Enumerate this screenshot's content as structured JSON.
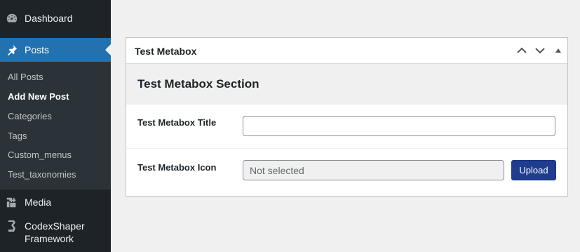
{
  "sidebar": {
    "dashboard": {
      "label": "Dashboard",
      "icon": "dashboard-icon"
    },
    "posts": {
      "label": "Posts",
      "icon": "pin-icon"
    },
    "submenu": [
      "All Posts",
      "Add New Post",
      "Categories",
      "Tags",
      "Custom_menus",
      "Test_taxonomies"
    ],
    "media": {
      "label": "Media",
      "icon": "media-icon"
    },
    "codexshaper": {
      "label_line1": "CodexShaper",
      "label_line2": "Framework",
      "icon": "codexshaper-icon"
    },
    "current_color": "#2271b1"
  },
  "metabox": {
    "title": "Test Metabox",
    "section_title": "Test Metabox Section",
    "fields": {
      "title_label": "Test Metabox Title",
      "title_value": "",
      "icon_label": "Test Metabox Icon",
      "icon_value": "Not selected",
      "upload_label": "Upload"
    },
    "button_color": "#1e3d8f"
  }
}
